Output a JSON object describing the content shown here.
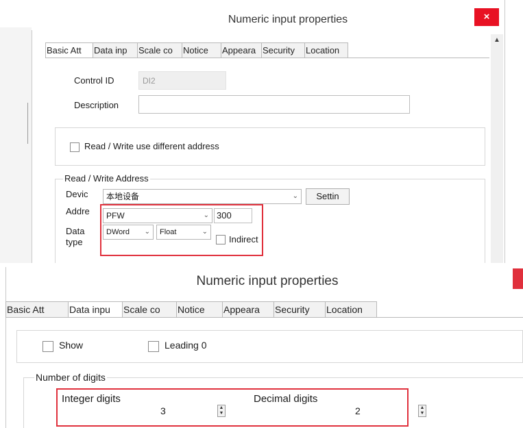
{
  "top_dialog": {
    "title": "Numeric input properties",
    "close_label": "×",
    "tabs": [
      "Basic Att",
      "Data inp",
      "Scale co",
      "Notice",
      "Appeara",
      "Security",
      "Location"
    ],
    "control_id": {
      "label": "Control ID",
      "value": "DI2"
    },
    "description": {
      "label": "Description",
      "value": ""
    },
    "rw_diff_checkbox": "Read / Write use different address",
    "rw_group": {
      "title": "Read / Write Address",
      "device_label": "Devic",
      "device_value": "本地设备",
      "settings_button": "Settin",
      "address_label": "Addre",
      "address_type": "PFW",
      "address_value": "300",
      "data_type_label_1": "Data",
      "data_type_label_2": "type",
      "data_width": "DWord",
      "data_format": "Float",
      "indirect_label": "Indirect"
    }
  },
  "bottom_dialog": {
    "title": "Numeric input properties",
    "tabs": [
      "Basic Att",
      "Data inpu",
      "Scale co",
      "Notice",
      "Appeara",
      "Security",
      "Location"
    ],
    "show_label": "Show",
    "leading_zero_label": "Leading 0",
    "digits_group": {
      "title": "Number of digits",
      "integer_label": "Integer digits",
      "integer_value": "3",
      "decimal_label": "Decimal digits",
      "decimal_value": "2"
    }
  },
  "colors": {
    "close": "#e81123",
    "highlight": "#e0303c"
  }
}
